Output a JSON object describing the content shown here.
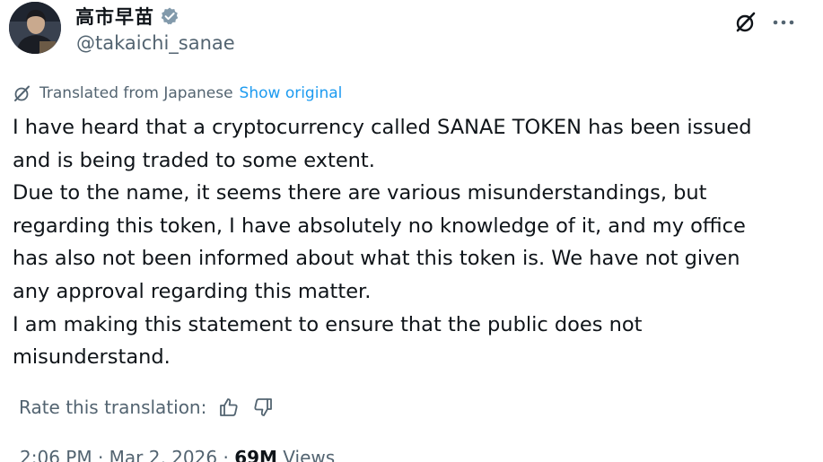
{
  "author": {
    "display_name": "高市早苗",
    "handle": "@takaichi_sanae",
    "verified": true
  },
  "icons": {
    "grok": "grok-slash-circle-icon",
    "more": "more-horizontal-icon",
    "translate": "translate-icon",
    "thumbs_up": "thumbs-up-icon",
    "thumbs_down": "thumbs-down-icon",
    "verified": "verified-badge-icon"
  },
  "translation": {
    "label": "Translated from Japanese",
    "show_original": "Show original"
  },
  "body": {
    "paragraphs": [
      "I have heard that a cryptocurrency called SANAE TOKEN has been issued\nand is being traded to some extent.",
      "Due to the name, it seems there are various misunderstandings, but\nregarding this token, I have absolutely no knowledge of it, and my office\nhas also not been informed about what this token is. We have not given\nany approval regarding this matter.",
      "I am making this statement to ensure that the public does not\nmisunderstand."
    ]
  },
  "rating": {
    "label": "Rate this translation:"
  },
  "meta": {
    "time": "2:06 PM",
    "separator": " · ",
    "date": "Mar 2, 2026",
    "views_count": "69M",
    "views_label": " Views"
  },
  "colors": {
    "text": "#0f1419",
    "secondary": "#536471",
    "link": "#1d9bf0",
    "verified": "#829aab"
  }
}
